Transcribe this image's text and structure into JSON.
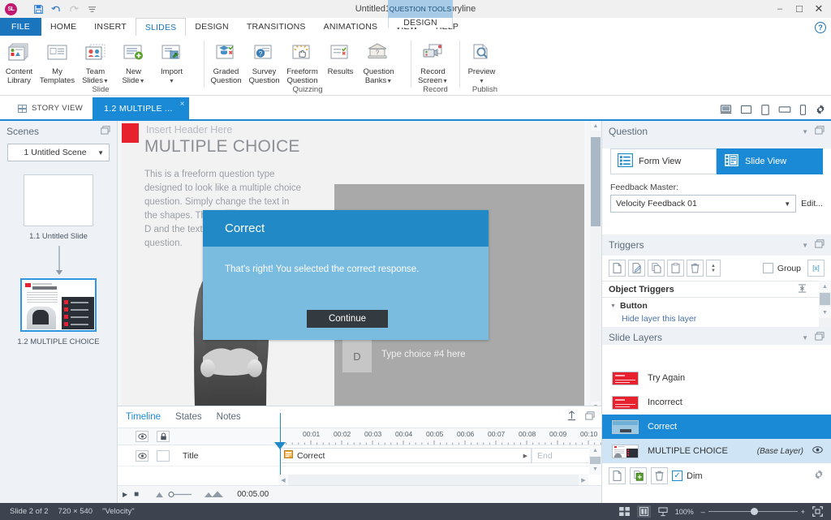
{
  "titlebar": {
    "logo": "SL",
    "document_title": "Untitled1* - Articulate Storyline",
    "context_tab": "QUESTION TOOLS",
    "quick_access": [
      {
        "name": "save-icon",
        "glyph": "▤"
      },
      {
        "name": "undo-icon",
        "glyph": "↶"
      },
      {
        "name": "redo-icon",
        "glyph": "↷"
      },
      {
        "name": "customize-qat-icon",
        "glyph": "☰"
      }
    ],
    "window_buttons": [
      {
        "name": "minimize-button",
        "glyph": "–"
      },
      {
        "name": "restore-button",
        "glyph": "❐"
      },
      {
        "name": "close-button",
        "glyph": "✕"
      }
    ]
  },
  "ribbon": {
    "tabs": [
      {
        "label": "FILE",
        "id": "file"
      },
      {
        "label": "HOME",
        "id": "home"
      },
      {
        "label": "INSERT",
        "id": "insert"
      },
      {
        "label": "SLIDES",
        "id": "slides"
      },
      {
        "label": "DESIGN",
        "id": "design"
      },
      {
        "label": "TRANSITIONS",
        "id": "transitions"
      },
      {
        "label": "ANIMATIONS",
        "id": "animations"
      },
      {
        "label": "VIEW",
        "id": "view"
      },
      {
        "label": "HELP",
        "id": "help"
      }
    ],
    "active_tab": "SLIDES",
    "context_tab_label": "DESIGN",
    "help_icon": "?",
    "groups": [
      {
        "label": "Slide",
        "buttons": [
          {
            "name": "content-library-button",
            "line1": "Content",
            "line2": "Library",
            "icon": "content-library-icon",
            "caret": false
          },
          {
            "name": "my-templates-button",
            "line1": "My",
            "line2": "Templates",
            "icon": "templates-icon",
            "caret": false
          },
          {
            "name": "team-slides-button",
            "line1": "Team",
            "line2": "Slides",
            "icon": "team-slides-icon",
            "caret": true
          },
          {
            "name": "new-slide-button",
            "line1": "New",
            "line2": "Slide",
            "icon": "new-slide-icon",
            "caret": true
          },
          {
            "name": "import-button",
            "line1": "Import",
            "line2": "",
            "icon": "import-icon",
            "caret": true
          }
        ]
      },
      {
        "label": "Quizzing",
        "buttons": [
          {
            "name": "graded-question-button",
            "line1": "Graded",
            "line2": "Question",
            "icon": "graded-question-icon",
            "caret": false
          },
          {
            "name": "survey-question-button",
            "line1": "Survey",
            "line2": "Question",
            "icon": "survey-question-icon",
            "caret": false
          },
          {
            "name": "freeform-question-button",
            "line1": "Freeform",
            "line2": "Question",
            "icon": "freeform-question-icon",
            "caret": false
          },
          {
            "name": "results-button",
            "line1": "Results",
            "line2": "",
            "icon": "results-icon",
            "caret": false
          },
          {
            "name": "question-banks-button",
            "line1": "Question",
            "line2": "Banks",
            "icon": "question-bank-icon",
            "caret": true
          }
        ]
      },
      {
        "label": "Record",
        "buttons": [
          {
            "name": "record-screen-button",
            "line1": "Record",
            "line2": "Screen",
            "icon": "record-screen-icon",
            "caret": true
          }
        ]
      },
      {
        "label": "Publish",
        "buttons": [
          {
            "name": "preview-button",
            "line1": "Preview",
            "line2": "",
            "icon": "preview-icon",
            "caret": true
          }
        ]
      }
    ]
  },
  "viewbar": {
    "story_view_label": "STORY VIEW",
    "slide_tab_label": "1.2 MULTIPLE ...",
    "slide_tab_close": "×",
    "device_icons": [
      {
        "name": "desktop-preview-icon"
      },
      {
        "name": "laptop-preview-icon"
      },
      {
        "name": "tablet-portrait-preview-icon"
      },
      {
        "name": "tablet-landscape-preview-icon"
      },
      {
        "name": "phone-preview-icon"
      },
      {
        "name": "player-settings-gear-icon"
      }
    ]
  },
  "scenes": {
    "title": "Scenes",
    "scene_selected": "1 Untitled Scene",
    "slides": [
      {
        "caption": "1.1 Untitled Slide",
        "selected": false
      },
      {
        "caption": "1.2 MULTIPLE CHOICE",
        "selected": true
      }
    ]
  },
  "slide": {
    "header_placeholder": "Insert Header Here",
    "title": "MULTIPLE CHOICE",
    "body": "This is a freeform question type designed to look like a multiple choice question. Simply change the text in the shapes. The choices run through D and the text shape above the question.",
    "choice_letter": "D",
    "choice_text": "Type choice #4 here",
    "dialog": {
      "title": "Correct",
      "message": "That's right!  You selected the correct response.",
      "button": "Continue"
    }
  },
  "timeline": {
    "tabs": [
      {
        "label": "Timeline",
        "active": true
      },
      {
        "label": "States",
        "active": false
      },
      {
        "label": "Notes",
        "active": false
      }
    ],
    "col_title": "Title",
    "ticks": [
      "00:01",
      "00:02",
      "00:03",
      "00:04",
      "00:05",
      "00:06",
      "00:07",
      "00:08",
      "00:09",
      "00:10"
    ],
    "bar_label": "Correct",
    "end_label": "End",
    "duration": "00:05.00",
    "tools": [
      {
        "name": "timeline-anchor-icon"
      },
      {
        "name": "timeline-dock-icon"
      }
    ]
  },
  "question_panel": {
    "title": "Question",
    "form_view_label": "Form View",
    "slide_view_label": "Slide View",
    "active_view": "Slide View",
    "feedback_master_label": "Feedback Master:",
    "feedback_master_value": "Velocity Feedback 01",
    "edit_label": "Edit..."
  },
  "triggers_panel": {
    "title": "Triggers",
    "tools": [
      {
        "name": "new-trigger-icon"
      },
      {
        "name": "edit-trigger-icon"
      },
      {
        "name": "copy-trigger-icon"
      },
      {
        "name": "paste-trigger-icon"
      },
      {
        "name": "delete-trigger-icon"
      },
      {
        "name": "reorder-trigger-icon"
      }
    ],
    "group_label": "Group",
    "variables_label": "[x]",
    "object_triggers_header": "Object Triggers",
    "object_name": "Button",
    "trigger_text": "Hide layer this layer"
  },
  "layers_panel": {
    "title": "Slide Layers",
    "layers": [
      {
        "name": "Try Again",
        "selected": false,
        "base": false,
        "color": "#e8212f"
      },
      {
        "name": "Incorrect",
        "selected": false,
        "base": false,
        "color": "#e8212f"
      },
      {
        "name": "Correct",
        "selected": true,
        "base": false,
        "color": "#8fc4e0"
      },
      {
        "name": "MULTIPLE CHOICE",
        "selected": false,
        "base": true,
        "base_label": "(Base Layer)",
        "color": "#ffffff"
      }
    ],
    "tools": [
      {
        "name": "new-layer-icon"
      },
      {
        "name": "duplicate-layer-icon"
      },
      {
        "name": "delete-layer-icon"
      }
    ],
    "dim_label": "Dim",
    "dim_checked": true,
    "settings_icon": "layer-properties-gear-icon"
  },
  "statusbar": {
    "slide_counter": "Slide 2 of 2",
    "dimensions": "720 × 540",
    "theme": "\"Velocity\"",
    "zoom_value": "100%",
    "zoom_out": "–",
    "zoom_in": "+",
    "view_icons": [
      {
        "name": "normal-view-icon"
      },
      {
        "name": "slide-master-view-icon"
      },
      {
        "name": "feedback-master-view-icon"
      }
    ],
    "fit_icon": "fit-to-window-icon"
  },
  "colors": {
    "accent": "#1b8ad6",
    "file_tab": "#1b75bc",
    "context": "#a8cbe8",
    "status_bg": "#3d4450",
    "dialog_head": "#2189c6",
    "dialog_body": "#79bce0",
    "red": "#e8212f"
  }
}
